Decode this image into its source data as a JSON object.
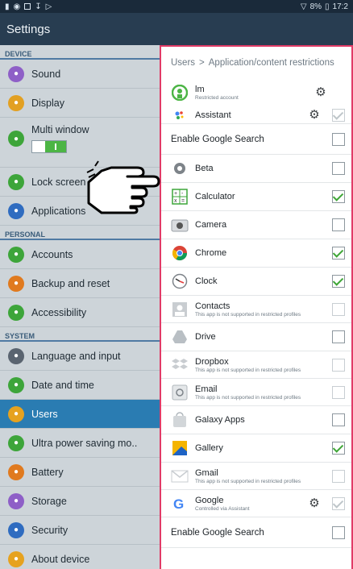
{
  "status_bar": {
    "battery": "8%",
    "time": "17:2"
  },
  "action_bar": {
    "title": "Settings"
  },
  "left_menu": {
    "sections": [
      {
        "header": "DEVICE",
        "items": [
          {
            "label": "Sound",
            "icon": "speaker-icon",
            "color": "#8e5fc7"
          },
          {
            "label": "Display",
            "icon": "display-icon",
            "color": "#e2a022"
          },
          {
            "label": "Multi window",
            "icon": "multi-window-icon",
            "color": "#3da53a",
            "toggle_on": true
          },
          {
            "label": "Lock screen",
            "icon": "lock-screen-icon",
            "color": "#3da53a"
          },
          {
            "label": "Applications",
            "icon": "applications-icon",
            "color": "#2f6cc0"
          }
        ]
      },
      {
        "header": "PERSONAL",
        "items": [
          {
            "label": "Accounts",
            "icon": "key-icon",
            "color": "#3da53a"
          },
          {
            "label": "Backup and reset",
            "icon": "backup-icon",
            "color": "#e07a1f"
          },
          {
            "label": "Accessibility",
            "icon": "accessibility-icon",
            "color": "#3da53a"
          }
        ]
      },
      {
        "header": "SYSTEM",
        "items": [
          {
            "label": "Language and input",
            "icon": "language-icon",
            "color": "#5a6470"
          },
          {
            "label": "Date and time",
            "icon": "date-time-icon",
            "color": "#3da53a"
          },
          {
            "label": "Users",
            "icon": "users-icon",
            "color": "#e6a21f",
            "active": true
          },
          {
            "label": "Ultra power saving mo..",
            "icon": "power-saving-icon",
            "color": "#3da53a"
          },
          {
            "label": "Battery",
            "icon": "battery-icon",
            "color": "#e07a1f"
          },
          {
            "label": "Storage",
            "icon": "storage-icon",
            "color": "#8e5fc7"
          },
          {
            "label": "Security",
            "icon": "security-icon",
            "color": "#2f6cc0"
          },
          {
            "label": "About device",
            "icon": "about-icon",
            "color": "#e6a21f"
          }
        ]
      }
    ]
  },
  "right_pane": {
    "breadcrumb_root": "Users",
    "breadcrumb_sep": ">",
    "breadcrumb_page": "Application/content restrictions",
    "profile": {
      "name": "lm",
      "sub": "Restricted account"
    },
    "apps": [
      {
        "key": "assistant",
        "label": "Assistant",
        "gear": true,
        "checked": true,
        "disabled": true,
        "icon": "assistant-icon"
      },
      {
        "key": "enable-google-search-1",
        "label": "Enable Google Search",
        "checked": false,
        "big": true
      },
      {
        "key": "beta",
        "label": "Beta",
        "checked": false,
        "icon": "beta-icon"
      },
      {
        "key": "calculator",
        "label": "Calculator",
        "checked": true,
        "icon": "calculator-icon"
      },
      {
        "key": "camera",
        "label": "Camera",
        "checked": false,
        "icon": "camera-icon"
      },
      {
        "key": "chrome",
        "label": "Chrome",
        "checked": true,
        "icon": "chrome-icon"
      },
      {
        "key": "clock",
        "label": "Clock",
        "checked": true,
        "icon": "clock-icon"
      },
      {
        "key": "contacts",
        "label": "Contacts",
        "sub": "This app is not supported in restricted profiles",
        "checked": false,
        "disabled": true,
        "icon": "contacts-icon"
      },
      {
        "key": "drive",
        "label": "Drive",
        "checked": false,
        "icon": "drive-icon"
      },
      {
        "key": "dropbox",
        "label": "Dropbox",
        "sub": "This app is not supported in restricted profiles",
        "checked": false,
        "disabled": true,
        "icon": "dropbox-icon"
      },
      {
        "key": "email",
        "label": "Email",
        "sub": "This app is not supported in restricted profiles",
        "checked": false,
        "disabled": true,
        "icon": "email-icon"
      },
      {
        "key": "galaxy-apps",
        "label": "Galaxy Apps",
        "checked": false,
        "icon": "galaxy-apps-icon"
      },
      {
        "key": "gallery",
        "label": "Gallery",
        "checked": true,
        "icon": "gallery-icon"
      },
      {
        "key": "gmail",
        "label": "Gmail",
        "sub": "This app is not supported in restricted profiles",
        "checked": false,
        "disabled": true,
        "icon": "gmail-icon"
      },
      {
        "key": "google",
        "label": "Google",
        "sub": "Controlled via Assistant",
        "gear": true,
        "checked": true,
        "disabled": true,
        "icon": "google-icon"
      },
      {
        "key": "enable-google-search-2",
        "label": "Enable Google Search",
        "checked": false,
        "big": true
      }
    ]
  }
}
